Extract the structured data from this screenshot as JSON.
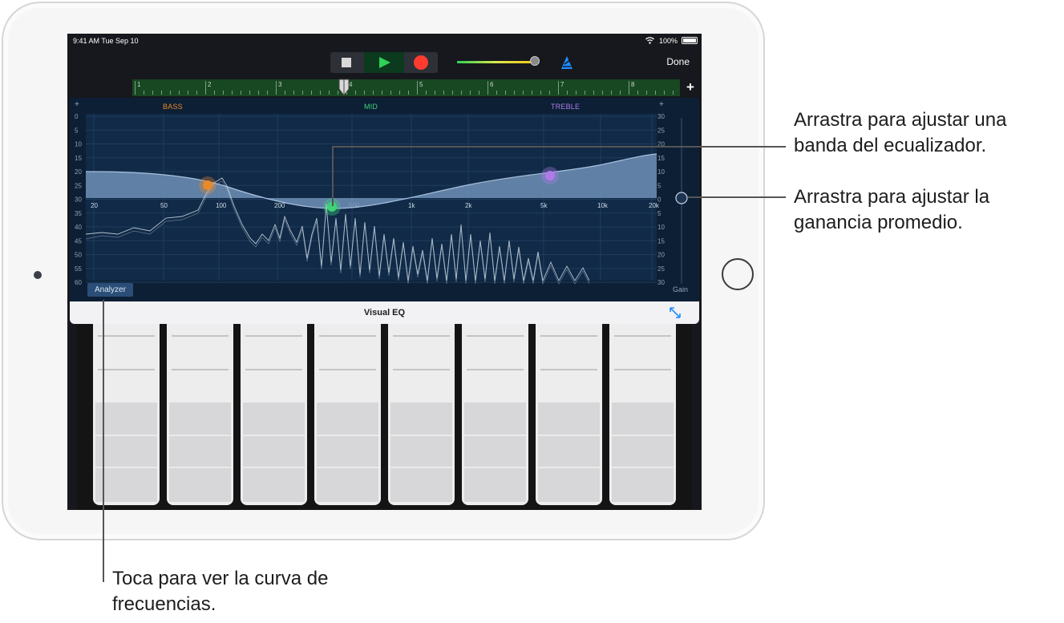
{
  "status_bar": {
    "time": "9:41 AM  Tue Sep 10",
    "battery": "100%",
    "icons": [
      "wifi-icon",
      "battery-icon"
    ]
  },
  "transport": {
    "buttons": [
      "stop-button",
      "play-button",
      "record-button"
    ],
    "volume_level": 0.97,
    "icons": [
      "stop-icon",
      "play-icon",
      "record-icon",
      "metronome-icon"
    ]
  },
  "done_label": "Done",
  "ruler": {
    "bars": [
      "1",
      "2",
      "3",
      "4",
      "5",
      "6",
      "7",
      "8"
    ],
    "add_label": "+"
  },
  "eq": {
    "bands": {
      "bass": "BASS",
      "mid": "MID",
      "treble": "TREBLE"
    },
    "corner_plus": "+",
    "left_scale": [
      "0",
      "5",
      "10",
      "15",
      "20",
      "25",
      "30",
      "35",
      "40",
      "45",
      "50",
      "55",
      "60"
    ],
    "right_scale": [
      "30",
      "25",
      "20",
      "15",
      "10",
      "5",
      "0",
      "5",
      "10",
      "15",
      "20",
      "25",
      "30"
    ],
    "freq_labels": [
      "20",
      "50",
      "100",
      "200",
      "500",
      "1k",
      "2k",
      "5k",
      "10k",
      "20k"
    ],
    "gain_label": "Gain",
    "analyzer_label": "Analyzer",
    "colors": {
      "bass": "#e8892a",
      "mid": "#40d37a",
      "treble": "#b07be9",
      "background": "#0c1f35"
    }
  },
  "panel_title": "Visual EQ",
  "keyboard": {
    "key_count": 8
  },
  "callouts": {
    "band": "Arrastra para ajustar una banda del ecualizador.",
    "gain": "Arrastra para ajustar la ganancia promedio.",
    "analyzer": "Toca para ver la curva de frecuencias."
  }
}
